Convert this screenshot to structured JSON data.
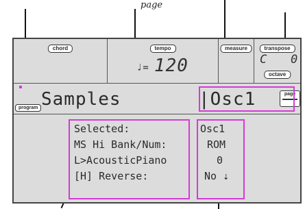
{
  "caption": "page",
  "header": {
    "chord_label": "chord",
    "tempo_label": "tempo",
    "tempo_note": "♩=",
    "tempo_value": "120",
    "measure_label": "measure",
    "transpose_label": "transpose",
    "transpose_value": "C   0",
    "octave_label": "octave"
  },
  "title_bar": {
    "program_tag": "program",
    "page_name": "Samples",
    "osc_label": "|Osc1",
    "page_button_label": "page"
  },
  "params": {
    "labels": [
      "Selected:",
      "MS Hi Bank/Num:",
      "L>AcousticPiano",
      "[H] Reverse:"
    ],
    "values": [
      "Osc1",
      "ROM",
      "0",
      "No ⇣"
    ]
  },
  "colors": {
    "highlight": "#d43bd6",
    "lcd_background": "#dcdcdc"
  }
}
